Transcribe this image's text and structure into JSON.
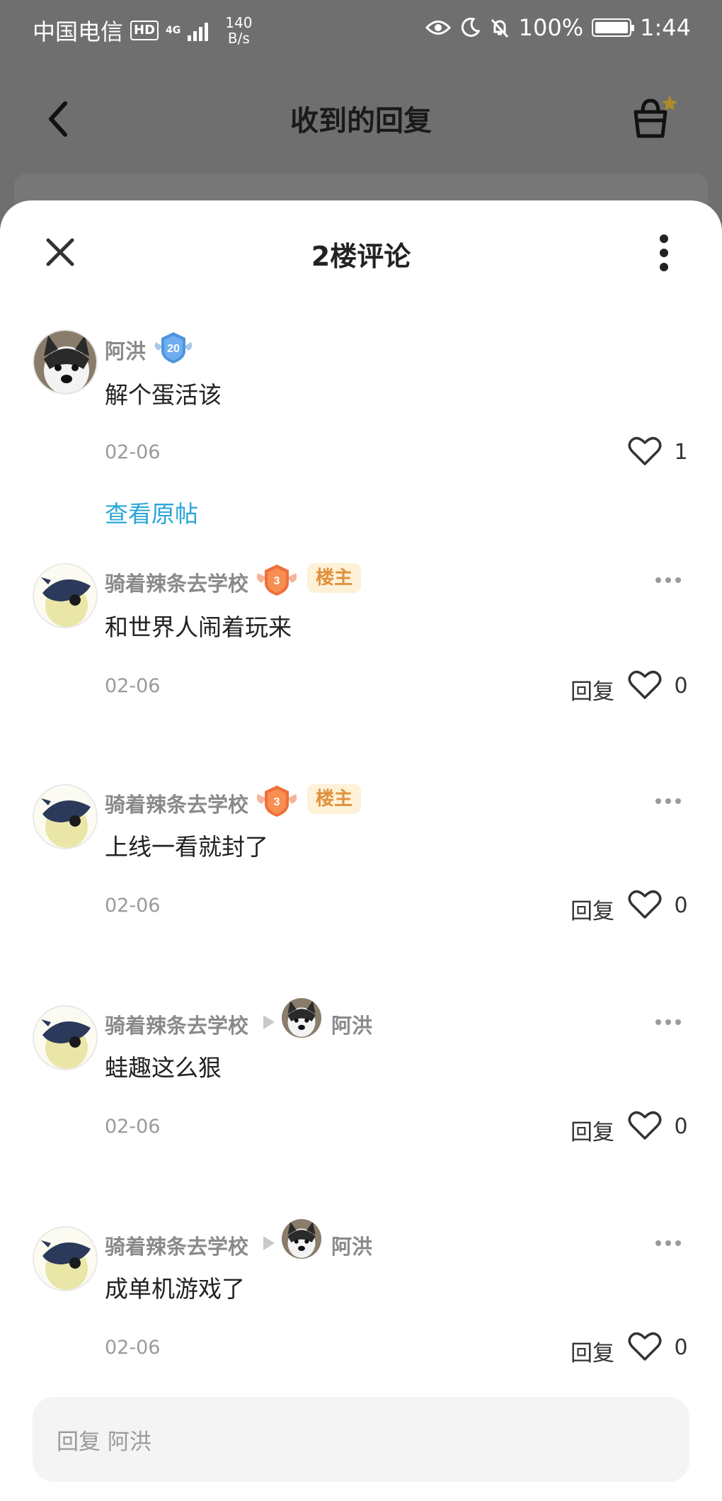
{
  "status_bar": {
    "carrier": "中国电信",
    "hd": "HD",
    "network": "4G",
    "speed_top": "140",
    "speed_bottom": "B/s",
    "battery": "100%",
    "time": "1:44"
  },
  "background": {
    "title": "收到的回复"
  },
  "sheet": {
    "title": "2楼评论"
  },
  "main_comment": {
    "name": "阿洪",
    "level": "20",
    "text": "解个蛋活该",
    "date": "02-06",
    "likes": "1",
    "view_post": "查看原帖"
  },
  "replies": [
    {
      "name": "骑着辣条去学校",
      "level": "3",
      "tag": "楼主",
      "text": "和世界人闹着玩来",
      "date": "02-06",
      "reply": "回复",
      "likes": "0"
    },
    {
      "name": "骑着辣条去学校",
      "level": "3",
      "tag": "楼主",
      "text": "上线一看就封了",
      "date": "02-06",
      "reply": "回复",
      "likes": "0"
    },
    {
      "name": "骑着辣条去学校",
      "target": "阿洪",
      "text": "蛙趣这么狠",
      "date": "02-06",
      "reply": "回复",
      "likes": "0"
    },
    {
      "name": "骑着辣条去学校",
      "target": "阿洪",
      "text": "成单机游戏了",
      "date": "02-06",
      "reply": "回复",
      "likes": "0"
    }
  ],
  "input": {
    "placeholder": "回复 阿洪"
  },
  "colors": {
    "link": "#2aa6d6",
    "owner_tag_bg": "#fdf1d8",
    "owner_tag_text": "#e0913a",
    "level_badge": "#f07a3c"
  }
}
